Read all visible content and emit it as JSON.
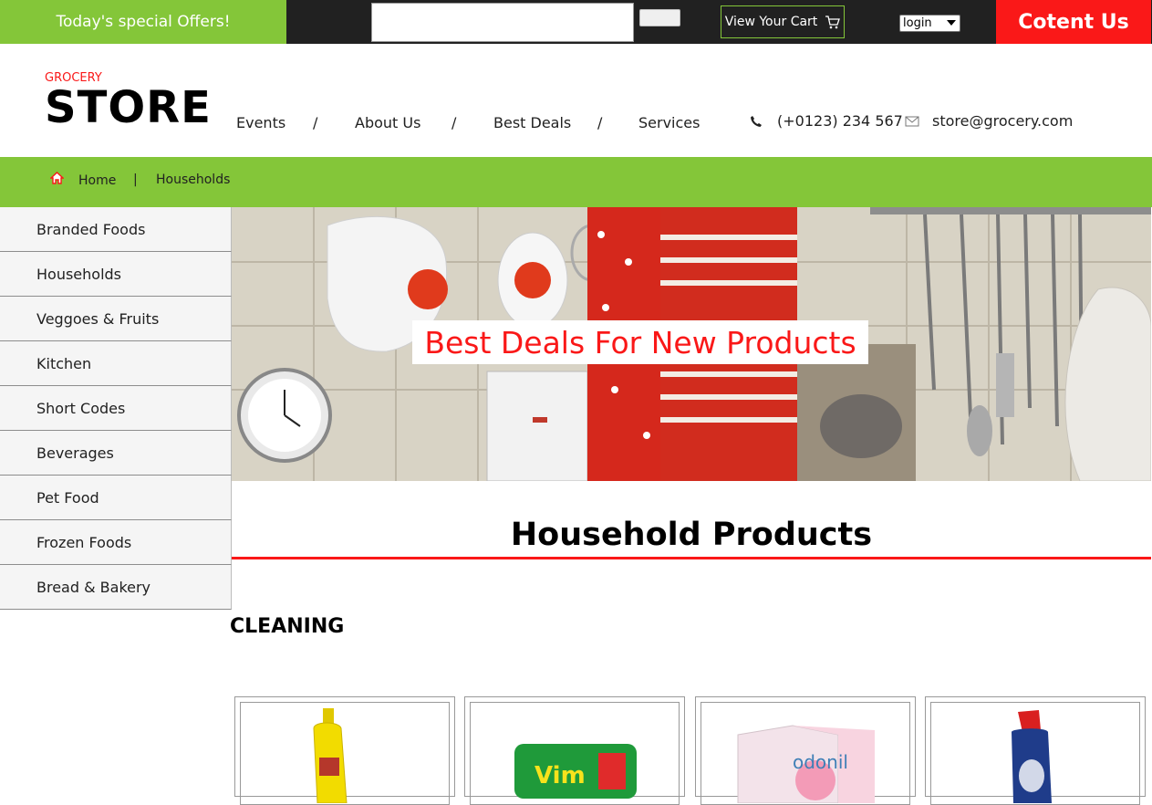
{
  "topbar": {
    "offers": "Today's special Offers!",
    "search_value": "",
    "search_button": "",
    "cart": "View Your Cart",
    "login_selected": "login",
    "contact": "Cotent Us",
    "colors": {
      "green": "#84c639",
      "red": "#fa1818",
      "dark": "#212121"
    }
  },
  "header": {
    "logo_small": "GROCERY",
    "logo_big": "STORE",
    "nav": [
      "Events",
      "About Us",
      "Best Deals",
      "Services"
    ],
    "nav_separator": "/",
    "phone": "(+0123) 234 567",
    "email": "store@grocery.com"
  },
  "breadcrumb": {
    "home": "Home",
    "separator": "|",
    "current": "Households"
  },
  "sidebar": {
    "items": [
      "Branded Foods",
      "Households",
      "Veggoes & Fruits",
      "Kitchen",
      "Short Codes",
      "Beverages",
      "Pet Food",
      "Frozen Foods",
      "Bread & Bakery"
    ]
  },
  "banner": {
    "text": "Best Deals For New Products"
  },
  "main": {
    "title": "Household Products",
    "category": "CLEANING"
  },
  "products": [
    {
      "image": "yellow-detergent-bottle"
    },
    {
      "image": "vim-dishwash-bar"
    },
    {
      "image": "odonil-air-freshener"
    },
    {
      "image": "toilet-cleaner-bottle"
    }
  ]
}
